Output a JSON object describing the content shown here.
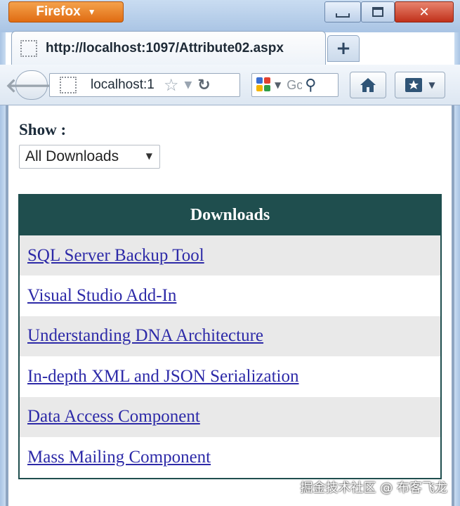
{
  "window": {
    "app_button_label": "Firefox",
    "minimize_glyph": "▭",
    "maximize_glyph": "▣",
    "close_glyph": "✕"
  },
  "tabs": [
    {
      "title": "http://localhost:1097/Attribute02.aspx",
      "icon": "page-icon"
    }
  ],
  "new_tab_glyph": "+",
  "navbar": {
    "url_text": "localhost:1",
    "search_placeholder": "Gc",
    "icons": [
      "back-arrow-icon",
      "site-identity-icon",
      "bookmark-star-icon",
      "reload-icon",
      "search-engine-icon",
      "magnifier-icon",
      "home-icon",
      "bookmarks-icon"
    ]
  },
  "page": {
    "show_label": "Show :",
    "filter_select": {
      "selected": "All Downloads"
    },
    "grid": {
      "header": "Downloads",
      "rows": [
        "SQL Server Backup Tool",
        "Visual Studio Add-In",
        "Understanding DNA Architecture",
        "In-depth XML and JSON Serialization",
        "Data Access Component",
        "Mass Mailing Component"
      ]
    }
  },
  "watermark": "掘金技术社区 @ 布客飞龙",
  "colors": {
    "grid_header_bg": "#1f4e4e",
    "link": "#2d2aa8",
    "alt_row": "#e9e9e9",
    "firefox_orange": "#e06c12"
  }
}
